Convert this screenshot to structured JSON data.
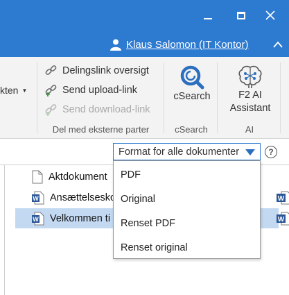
{
  "titlebar": {
    "background": "#2d7ad1",
    "user_label": "Klaus Salomon (IT Kontor)",
    "minimize_glyph": "–",
    "collapse_glyph": "∧"
  },
  "ribbon": {
    "partial_label": "kten",
    "share_group": {
      "items": [
        {
          "label": "Delingslink oversigt",
          "icon": "link-icon",
          "enabled": true
        },
        {
          "label": "Send upload-link",
          "icon": "upload-link-icon",
          "enabled": true
        },
        {
          "label": "Send download-link",
          "icon": "download-link-icon",
          "enabled": false
        }
      ],
      "label": "Del med eksterne parter"
    },
    "csearch": {
      "button_label": "cSearch",
      "group_label": "cSearch",
      "icon": "csearch-icon"
    },
    "ai": {
      "button_label_line1": "F2 AI",
      "button_label_line2": "Assistant",
      "group_label": "AI",
      "icon": "brain-icon"
    }
  },
  "format_select": {
    "value": "Format for alle dokumenter",
    "options": [
      "PDF",
      "Original",
      "Renset PDF",
      "Renset original"
    ]
  },
  "help": {
    "glyph": "?"
  },
  "documents": [
    {
      "name": "Aktdokument",
      "icon": "blank-document-icon",
      "selected": false
    },
    {
      "name": "Ansættelsesko",
      "icon": "word-document-icon",
      "selected": false
    },
    {
      "name": "Velkommen ti",
      "icon": "word-document-icon",
      "selected": true
    }
  ],
  "colors": {
    "accent": "#2d7ad1",
    "selection": "#c3d9f2",
    "word_blue": "#2b5797"
  }
}
